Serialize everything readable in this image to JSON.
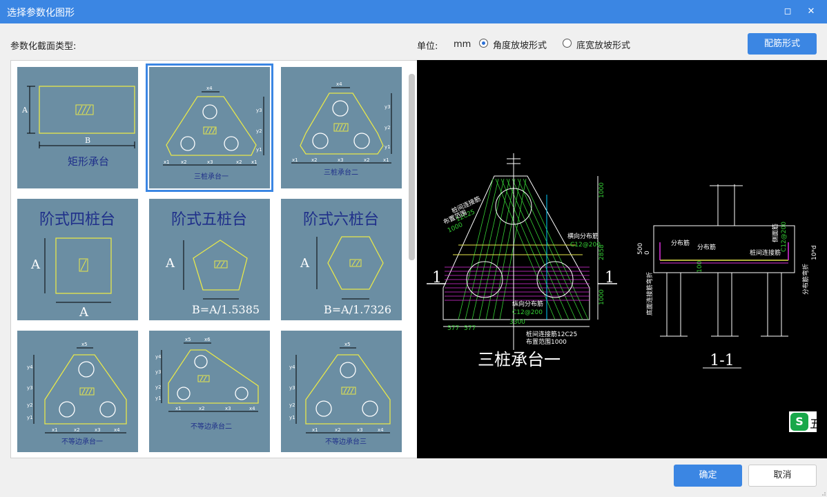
{
  "window": {
    "title": "选择参数化图形",
    "maximize_glyph": "◻",
    "close_glyph": "✕"
  },
  "toolbar": {
    "section_label": "参数化截面类型:",
    "unit_label": "单位:",
    "unit_value": "mm",
    "radio_angle_label": "角度放坡形式",
    "radio_width_label": "底宽放坡形式",
    "radio_selected": "角度放坡形式",
    "rebar_button": "配筋形式"
  },
  "gallery": {
    "selected_index": 1,
    "tiles": [
      {
        "label": "矩形承台",
        "dims": [
          "A",
          "B"
        ]
      },
      {
        "label": "三桩承台一",
        "dims": [
          "x4",
          "y3",
          "y2",
          "y1",
          "x1",
          "x2",
          "x3",
          "x2",
          "x1"
        ]
      },
      {
        "label": "三桩承台二",
        "dims": [
          "x4",
          "y3",
          "y2",
          "y1",
          "x1",
          "x2",
          "x3",
          "x2",
          "x1"
        ]
      },
      {
        "label": "阶式四桩台",
        "dims": [
          "A",
          "A"
        ]
      },
      {
        "label": "阶式五桩台",
        "dims": [
          "A",
          "B=A/1.5385"
        ]
      },
      {
        "label": "阶式六桩台",
        "dims": [
          "A",
          "B=A/1.7326"
        ]
      },
      {
        "label": "不等边承台一",
        "dims": [
          "x5",
          "y4",
          "y3",
          "y2",
          "y1",
          "x1",
          "x2",
          "x3",
          "x4"
        ]
      },
      {
        "label": "不等边承台二",
        "dims": [
          "x5",
          "x6",
          "y4",
          "y3",
          "y2",
          "y1",
          "x1",
          "x2",
          "x3",
          "x4"
        ]
      },
      {
        "label": "不等边承台三",
        "dims": [
          "x5",
          "y4",
          "y3",
          "y2",
          "y1",
          "x1",
          "x2",
          "x3",
          "x4"
        ]
      }
    ]
  },
  "preview": {
    "plan_title": "三桩承台一",
    "section_title": "1-1",
    "section_mark": "1",
    "plan_notes": [
      "桩间连接筋",
      "12C25",
      "布置范围",
      "1000",
      "横向分布筋",
      "C12@200",
      "纵向分布筋",
      "C12@200",
      "桩间连接筋12C25",
      "布置范围1000"
    ],
    "plan_dims": [
      "1000",
      "2858",
      "1000",
      "3300",
      "577",
      "577"
    ],
    "section_notes": [
      "分布筋",
      "分布筋",
      "桩间连接筋",
      "侧面筋",
      "C12@200",
      "底面连接筋弯折",
      "分布筋弯折",
      "500",
      "0",
      "100",
      "10*d"
    ]
  },
  "wps": {
    "badge": "S",
    "text": "五"
  },
  "footer": {
    "ok": "确定",
    "cancel": "取消"
  }
}
